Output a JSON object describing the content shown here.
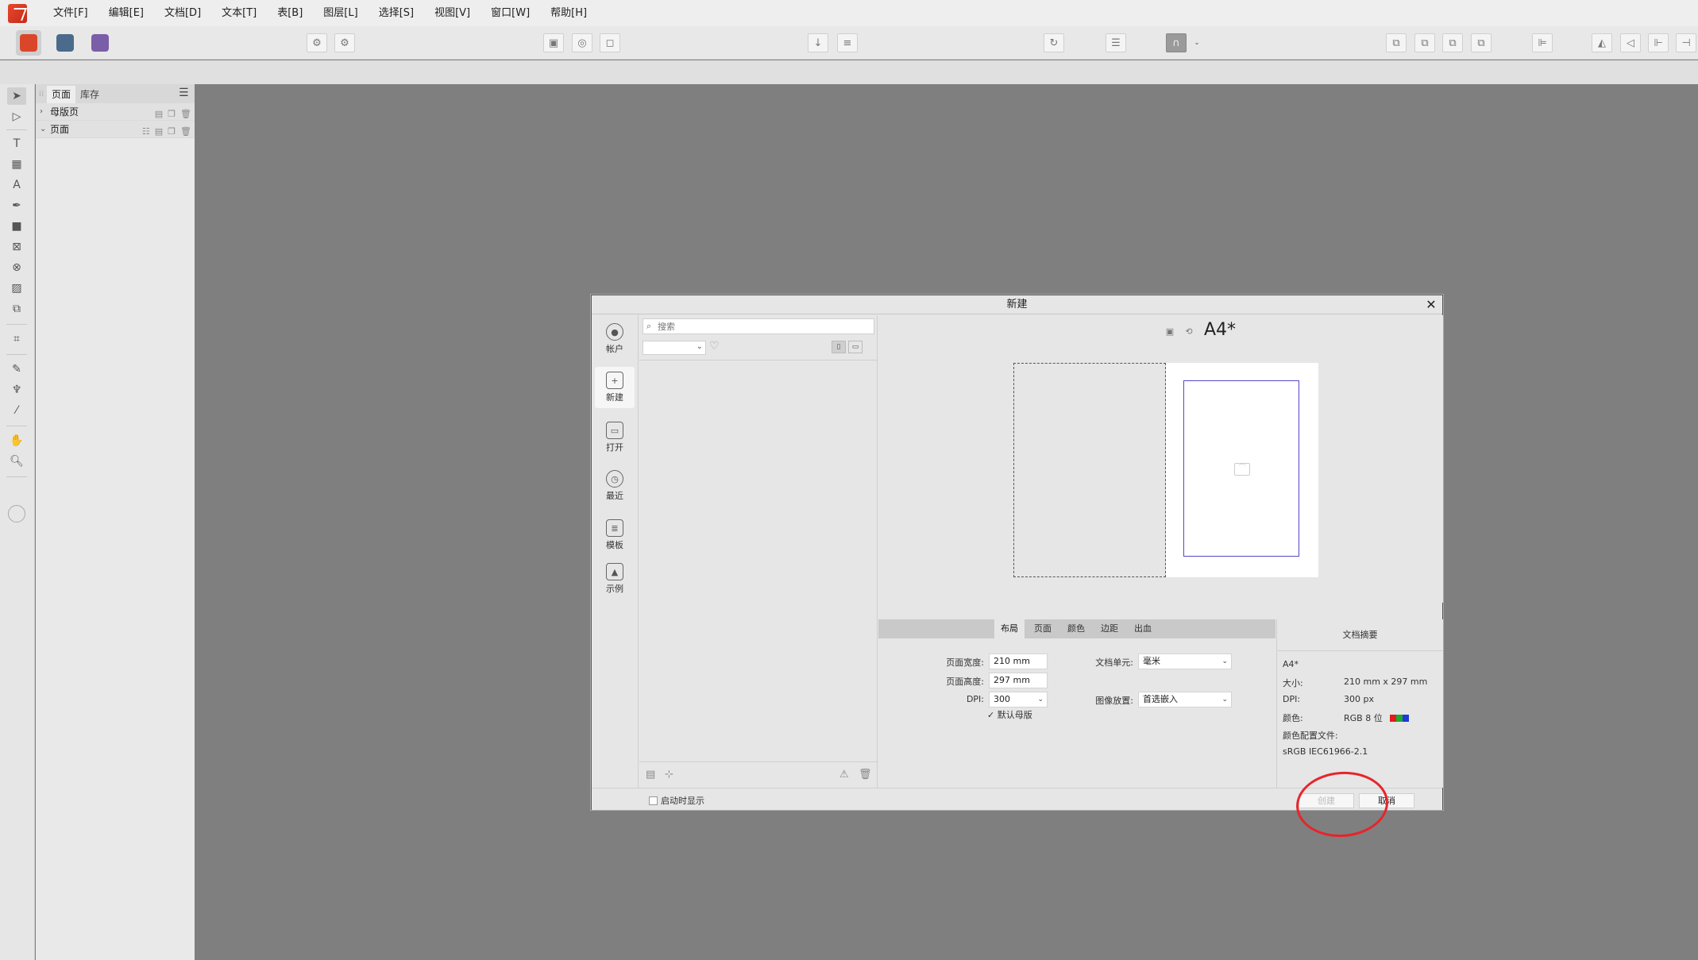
{
  "menubar": {
    "items": [
      "文件[F]",
      "编辑[E]",
      "文档[D]",
      "文本[T]",
      "表[B]",
      "图层[L]",
      "选择[S]",
      "视图[V]",
      "窗口[W]",
      "帮助[H]"
    ]
  },
  "pages_panel": {
    "tabs": [
      "页面",
      "库存"
    ],
    "rows": [
      "母版页",
      "页面"
    ]
  },
  "dialog": {
    "title": "新建",
    "nav": [
      "帐户",
      "新建",
      "打开",
      "最近",
      "模板",
      "示例"
    ],
    "search_placeholder": "搜索",
    "preset_name": "A4*",
    "tabs": [
      "布局",
      "页面",
      "颜色",
      "边距",
      "出血"
    ],
    "fields": {
      "page_width_label": "页面宽度:",
      "page_width": "210 mm",
      "page_height_label": "页面高度:",
      "page_height": "297 mm",
      "dpi_label": "DPI:",
      "dpi": "300",
      "default_master": "默认母版",
      "doc_units_label": "文档单元:",
      "doc_units": "毫米",
      "image_placement_label": "图像放置:",
      "image_placement": "首选嵌入"
    },
    "summary": {
      "title": "文档摘要",
      "name": "A4*",
      "size_label": "大小:",
      "size": "210 mm  x  297 mm",
      "dpi_label": "DPI:",
      "dpi": "300 px",
      "color_label": "颜色:",
      "color": "RGB 8 位",
      "profile_label": "颜色配置文件:",
      "profile": "sRGB IEC61966-2.1"
    },
    "footer": {
      "show_on_startup": "启动时显示",
      "create": "创建",
      "cancel": "取消"
    }
  },
  "colors": {
    "annotation": "#e8242b",
    "page_border": "#5447c9"
  }
}
